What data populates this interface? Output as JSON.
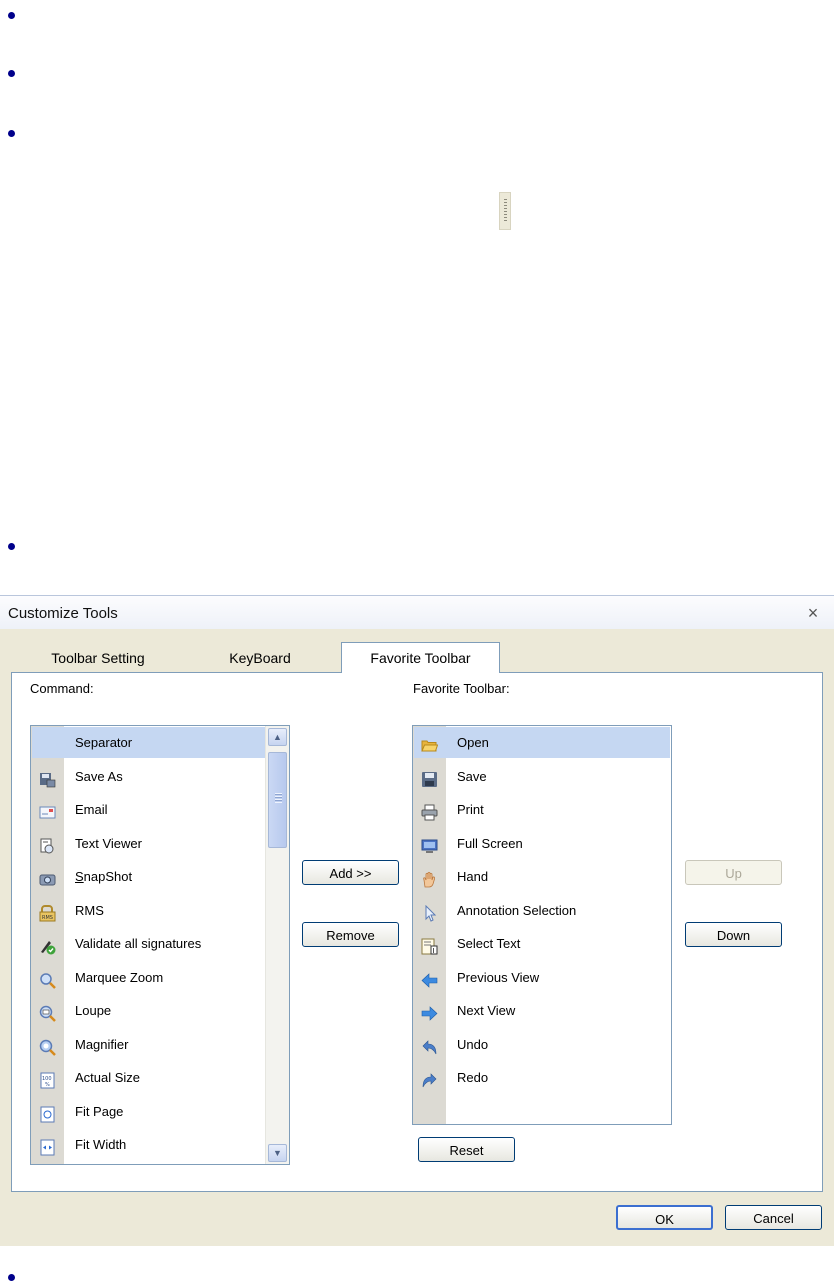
{
  "dialog": {
    "title": "Customize Tools",
    "close_symbol": "×",
    "tabs": [
      {
        "label": "Toolbar Setting",
        "active": false
      },
      {
        "label": "KeyBoard",
        "active": false
      },
      {
        "label": "Favorite Toolbar",
        "active": true
      }
    ],
    "command_label": "Command:",
    "favorite_label": "Favorite Toolbar:",
    "commands": [
      {
        "label": "Separator",
        "icon": "separator",
        "selected": true
      },
      {
        "label": "Save As",
        "icon": "save-as-icon"
      },
      {
        "label": "Email",
        "icon": "email-icon"
      },
      {
        "label": "Text Viewer",
        "icon": "text-viewer-icon"
      },
      {
        "label": "SnapShot",
        "icon": "snapshot-icon",
        "mnemonic": "S"
      },
      {
        "label": "RMS",
        "icon": "rms-icon"
      },
      {
        "label": "Validate all signatures",
        "icon": "validate-signatures-icon"
      },
      {
        "label": "Marquee Zoom",
        "icon": "marquee-zoom-icon"
      },
      {
        "label": "Loupe",
        "icon": "loupe-icon"
      },
      {
        "label": "Magnifier",
        "icon": "magnifier-icon"
      },
      {
        "label": "Actual Size",
        "icon": "actual-size-icon"
      },
      {
        "label": "Fit Page",
        "icon": "fit-page-icon"
      },
      {
        "label": "Fit Width",
        "icon": "fit-width-icon"
      }
    ],
    "favorites": [
      {
        "label": "Open",
        "icon": "folder-open-icon",
        "selected": true
      },
      {
        "label": "Save",
        "icon": "save-icon"
      },
      {
        "label": "Print",
        "icon": "print-icon"
      },
      {
        "label": "Full Screen",
        "icon": "full-screen-icon"
      },
      {
        "label": "Hand",
        "icon": "hand-icon"
      },
      {
        "label": "Annotation Selection",
        "icon": "annotation-selection-icon"
      },
      {
        "label": "Select Text",
        "icon": "select-text-icon"
      },
      {
        "label": "Previous View",
        "icon": "arrow-left-icon"
      },
      {
        "label": "Next View",
        "icon": "arrow-right-icon"
      },
      {
        "label": "Undo",
        "icon": "undo-icon"
      },
      {
        "label": "Redo",
        "icon": "redo-icon"
      }
    ],
    "buttons": {
      "add": "Add >>",
      "remove": "Remove",
      "up": "Up",
      "down": "Down",
      "reset": "Reset",
      "ok": "OK",
      "cancel": "Cancel"
    },
    "colors": {
      "selection": "#c5d7f2",
      "dialog_bg": "#ece9d8",
      "border": "#7f9db9",
      "bullet": "#00008b"
    }
  }
}
